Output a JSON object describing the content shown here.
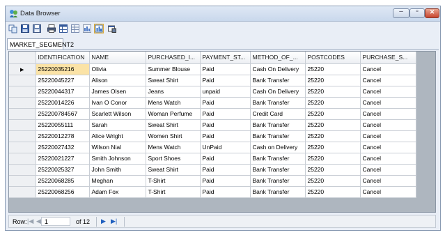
{
  "window": {
    "title": "Data Browser"
  },
  "tab": {
    "label": "MARKET_SEGMENT2"
  },
  "toolbar": {
    "buttons": [
      "copy-icon",
      "save-icon",
      "save-as-icon",
      "print-icon",
      "grid-view-icon",
      "table-view-icon",
      "data-table-icon",
      "chart-icon",
      "properties-icon"
    ]
  },
  "grid": {
    "columns": [
      "IDENTIFICATION",
      "NAME",
      "PURCHASED_I...",
      "PAYMENT_ST...",
      "METHOD_OF_...",
      "POSTCODES",
      "PURCHASE_S..."
    ],
    "rows": [
      [
        "25220035216",
        "Olivia",
        "Summer Blouse",
        "Paid",
        "Cash On Delivery",
        "25220",
        "Cancel"
      ],
      [
        "25220045227",
        "Alison",
        "Sweat Shirt",
        "Paid",
        "Bank Transfer",
        "25220",
        "Cancel"
      ],
      [
        "25220044317",
        "James Olsen",
        "Jeans",
        "unpaid",
        "Cash On Delivery",
        "25220",
        "Cancel"
      ],
      [
        "25220014226",
        "Ivan O Conor",
        "Mens Watch",
        "Paid",
        "Bank Transfer",
        "25220",
        "Cancel"
      ],
      [
        "252200784567",
        "Scarlett Wilson",
        "Woman Perfume",
        "Paid",
        "Credit Card",
        "25220",
        "Cancel"
      ],
      [
        "25220055111",
        "Sarah",
        "Sweat Shirt",
        "Paid",
        "Bank Transfer",
        "25220",
        "Cancel"
      ],
      [
        "25220012278",
        "Alice Wright",
        "Women Shirt",
        "Paid",
        "Bank Transfer",
        "25220",
        "Cancel"
      ],
      [
        "25220027432",
        "Wilson Nial",
        "Mens Watch",
        "UnPaid",
        "Cash on Delivery",
        "25220",
        "Cancel"
      ],
      [
        "25220021227",
        "Smith Johnson",
        "Sport Shoes",
        "Paid",
        "Bank Transfer",
        "25220",
        "Cancel"
      ],
      [
        "25220025327",
        "John Smith",
        "Sweat Shirt",
        "Paid",
        "Bank Transfer",
        "25220",
        "Cancel"
      ],
      [
        "25220068285",
        "Meghan",
        "T-Shirt",
        "Paid",
        "Bank Transfer",
        "25220",
        "Cancel"
      ],
      [
        "25220068256",
        "Adam Fox",
        "T-Shirt",
        "Paid",
        "Bank Transfer",
        "25220",
        "Cancel"
      ]
    ],
    "current_row_marker": "▶"
  },
  "navigator": {
    "row_label": "Row:",
    "position": "1",
    "of_text": "of 12"
  },
  "colors": {
    "selected_cell": "#fbe3a6",
    "grid_background": "#aeb6bf"
  }
}
